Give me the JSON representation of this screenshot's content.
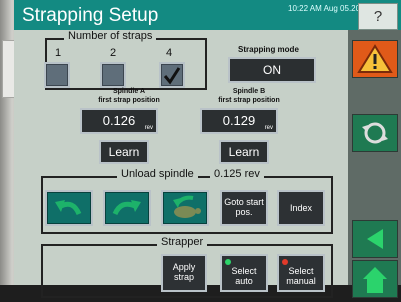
{
  "window": {
    "title": "Strapping Setup",
    "clock": "10:22 AM Aug 05.20",
    "help_label": "?"
  },
  "num_straps": {
    "title": "Number of straps",
    "labels": [
      "1",
      "2",
      "4"
    ],
    "selected": "4"
  },
  "mode": {
    "title": "Strapping mode",
    "value": "ON"
  },
  "spindle_a": {
    "title_line1": "Spindle A",
    "title_line2": "first strap position",
    "value": "0.126",
    "unit": "rev",
    "learn_label": "Learn"
  },
  "spindle_b": {
    "title_line1": "Spindle B",
    "title_line2": "first strap position",
    "value": "0.129",
    "unit": "rev",
    "learn_label": "Learn"
  },
  "unload": {
    "title": "Unload spindle",
    "value": "0.125 rev",
    "goto_line1": "Goto start",
    "goto_line2": "pos.",
    "index_label": "Index"
  },
  "strapper": {
    "title": "Strapper",
    "apply_line1": "Apply",
    "apply_line2": "strap",
    "auto_line1": "Select",
    "auto_line2": "auto",
    "manual_line1": "Select",
    "manual_line2": "manual"
  },
  "colors": {
    "titlebar": "#138a82",
    "screen": "#c6d0c8",
    "warning": "#e05a19",
    "green": "#1f7a52"
  },
  "icons": [
    "warning-icon",
    "rotate-icon",
    "back-arrow-icon",
    "rotate-left-arrow-icon",
    "rotate-right-arrow-icon",
    "turtle-icon"
  ]
}
